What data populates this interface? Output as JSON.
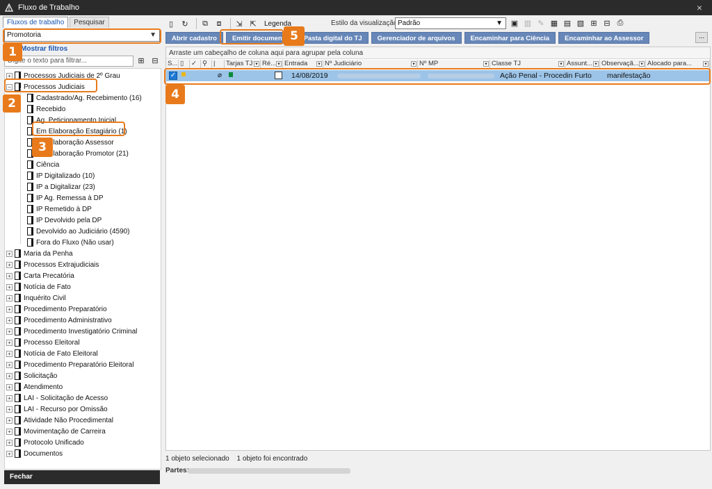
{
  "window": {
    "title": "Fluxo de Trabalho",
    "close_glyph": "×"
  },
  "left": {
    "tabs": [
      {
        "label": "Fluxos de trabalho"
      },
      {
        "label": "Pesquisar"
      }
    ],
    "workflow_select": {
      "value": "Promotoria"
    },
    "filters_link": "Mostrar filtros",
    "filter_input": {
      "placeholder": "Digite o texto para filtrar..."
    },
    "tree": [
      {
        "label": "Processos Judiciais de 2º Grau"
      },
      {
        "label": "Processos Judiciais",
        "children": [
          "Cadastrado/Ag. Recebimento (16)",
          "Recebido",
          "Ag. Peticionamento Inicial",
          "Em Elaboração Estagiário (1)",
          "Em Elaboração Assessor",
          "Em Elaboração Promotor (21)",
          "Ciência",
          "IP Digitalizado (10)",
          "IP a Digitalizar (23)",
          "IP Ag. Remessa à DP",
          "IP Remetido à DP",
          "IP Devolvido pela DP",
          "Devolvido ao Judiciário (4590)",
          "Fora do Fluxo (Não usar)"
        ]
      },
      {
        "label": "Maria da Penha"
      },
      {
        "label": "Processos Extrajudiciais"
      },
      {
        "label": "Carta Precatória"
      },
      {
        "label": "Notícia de Fato"
      },
      {
        "label": "Inquérito Civil"
      },
      {
        "label": "Procedimento Preparatório"
      },
      {
        "label": "Procedimento Administrativo"
      },
      {
        "label": "Procedimento Investigatório Criminal"
      },
      {
        "label": "Processo Eleitoral"
      },
      {
        "label": "Notícia de Fato Eleitoral"
      },
      {
        "label": "Procedimento Preparatório Eleitoral"
      },
      {
        "label": "Solicitação"
      },
      {
        "label": "Atendimento"
      },
      {
        "label": "LAI - Solicitação de Acesso"
      },
      {
        "label": "LAI - Recurso por Omissão"
      },
      {
        "label": "Atividade Não Procedimental"
      },
      {
        "label": "Movimentação de Carreira"
      },
      {
        "label": "Protocolo Unificado"
      },
      {
        "label": "Documentos"
      }
    ],
    "close_button": "Fechar"
  },
  "toolbar": {
    "legend_label": "Legenda",
    "style_label": "Estilo da visualização",
    "style_value": "Padrão"
  },
  "actions": [
    "Abrir cadastro",
    "Emitir documento",
    "Pasta digital do TJ",
    "Gerenciador de arquivos",
    "Encaminhar para Ciência",
    "Encaminhar ao Assessor"
  ],
  "more_button": "...",
  "grid": {
    "group_hint": "Arraste um cabeçalho de coluna aqui para agrupar pela coluna",
    "columns": [
      "S...",
      "",
      "",
      "",
      "Tarjas TJ",
      "Ré...",
      "Entrada",
      "Nº Judiciário",
      "Nº MP",
      "Classe TJ",
      "Assunt...",
      "Observaçã...",
      "Alocado para..."
    ],
    "rows": [
      {
        "entrada": "14/08/2019",
        "classe": "Ação Penal - Procedin Furto",
        "observacao": "manifestação"
      }
    ]
  },
  "status": {
    "selected": "1 objeto selecionado",
    "found": "1 objeto foi encontrado",
    "partes_label": "Partes:"
  },
  "annotations": [
    "1",
    "2",
    "3",
    "4",
    "5"
  ],
  "colors": {
    "accent": "#e87a1b",
    "action_button": "#6787b8",
    "selected_row": "#9cc4e8",
    "titlebar": "#2b2b2b"
  }
}
